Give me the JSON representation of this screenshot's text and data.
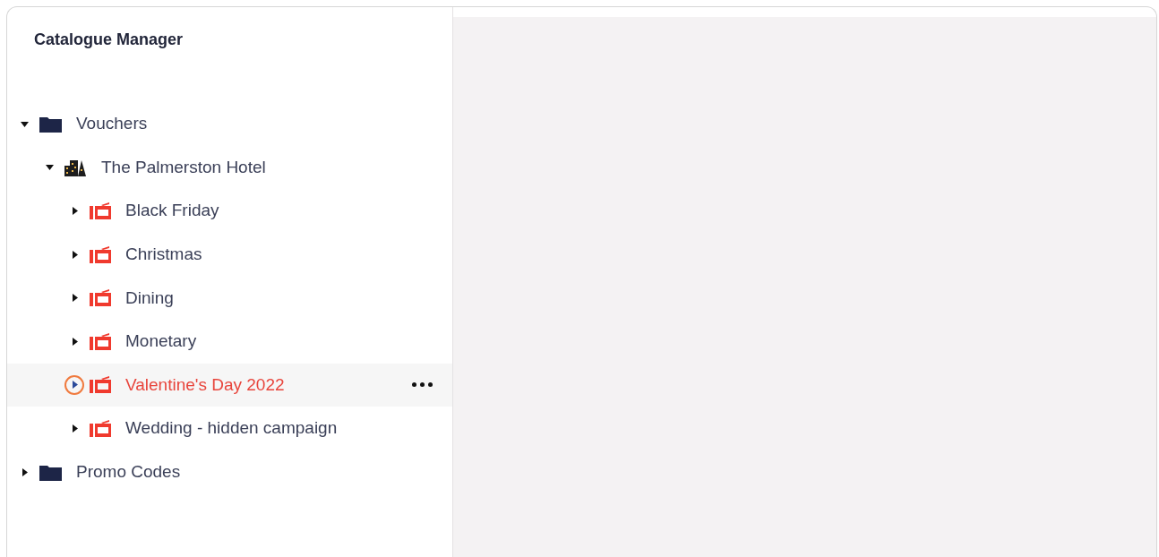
{
  "panel": {
    "title": "Catalogue Manager"
  },
  "tree": [
    {
      "label": "Vouchers",
      "kind": "folder",
      "expanded": true,
      "selected": false,
      "children": [
        {
          "label": "The Palmerston Hotel",
          "kind": "building",
          "expanded": true,
          "selected": false,
          "children": [
            {
              "label": "Black Friday",
              "kind": "campaign",
              "expanded": false,
              "selected": false
            },
            {
              "label": "Christmas",
              "kind": "campaign",
              "expanded": false,
              "selected": false
            },
            {
              "label": "Dining",
              "kind": "campaign",
              "expanded": false,
              "selected": false
            },
            {
              "label": "Monetary",
              "kind": "campaign",
              "expanded": false,
              "selected": false
            },
            {
              "label": "Valentine's Day 2022",
              "kind": "campaign",
              "expanded": false,
              "selected": true
            },
            {
              "label": "Wedding - hidden campaign",
              "kind": "campaign",
              "expanded": false,
              "selected": false
            }
          ]
        }
      ]
    },
    {
      "label": "Promo Codes",
      "kind": "folder",
      "expanded": false,
      "selected": false
    }
  ]
}
